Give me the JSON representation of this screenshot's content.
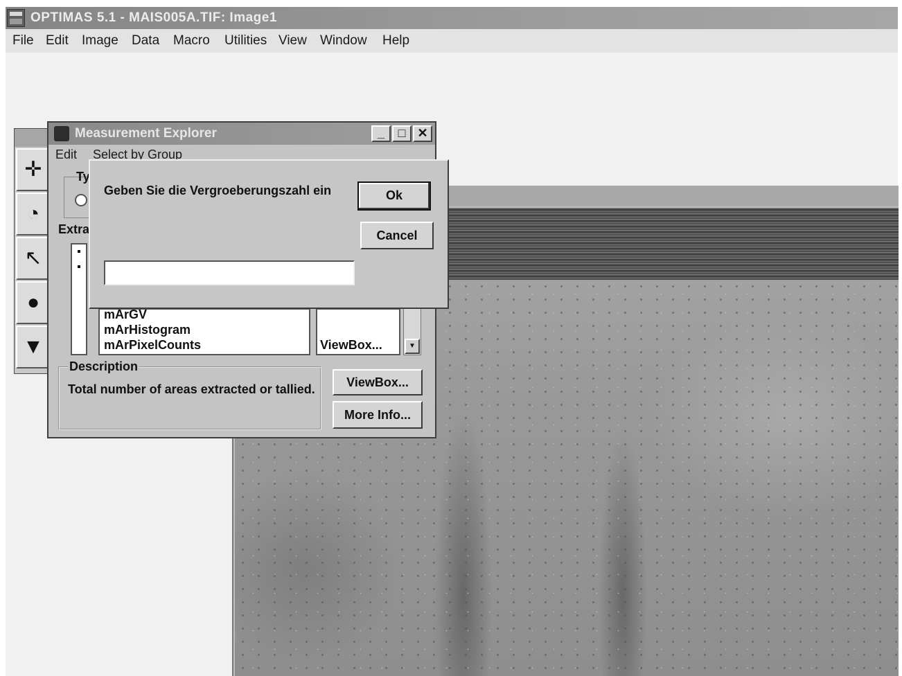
{
  "app": {
    "title": "OPTIMAS 5.1  - MAIS005A.TIF: Image1",
    "menu": [
      "File",
      "Edit",
      "Image",
      "Data",
      "Macro",
      "Utilities",
      "View",
      "Window",
      "Help"
    ]
  },
  "measurement_explorer": {
    "title": "Measurement Explorer",
    "menu": [
      "Edit",
      "Select by Group"
    ],
    "type_label": "Ty",
    "extract_label": "Extra",
    "list_items": [
      "mArGV",
      "mArHistogram",
      "mArPixelCounts"
    ],
    "side_list_text": "ViewBox...",
    "description_label": "Description",
    "description_text": "Total number of areas extracted or tallied.",
    "viewbox_button": "ViewBox...",
    "more_info_button": "More Info..."
  },
  "dialog": {
    "prompt": "Geben Sie die Vergroeberungszahl ein",
    "ok_label": "Ok",
    "cancel_label": "Cancel",
    "input_value": ""
  }
}
